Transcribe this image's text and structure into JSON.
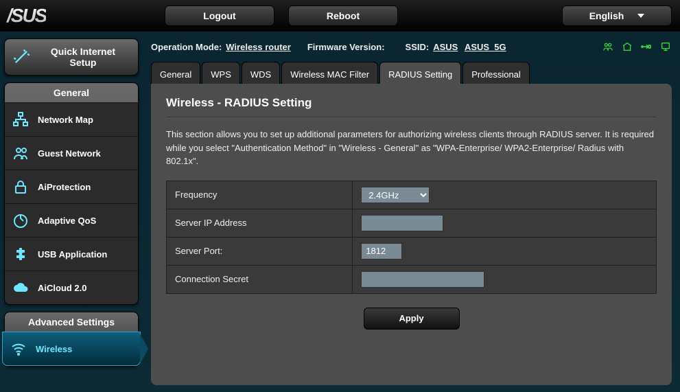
{
  "brand": "/SUS",
  "topbar": {
    "logout": "Logout",
    "reboot": "Reboot",
    "language": "English"
  },
  "status": {
    "op_mode_label": "Operation Mode:",
    "op_mode_value": "Wireless router",
    "fw_label": "Firmware Version:",
    "ssid_label": "SSID:",
    "ssid_24": "ASUS",
    "ssid_5": "ASUS_5G"
  },
  "sidebar": {
    "quick_label": "Quick Internet Setup",
    "general_header": "General",
    "general_items": [
      {
        "label": "Network Map"
      },
      {
        "label": "Guest Network"
      },
      {
        "label": "AiProtection"
      },
      {
        "label": "Adaptive QoS"
      },
      {
        "label": "USB Application"
      },
      {
        "label": "AiCloud 2.0"
      }
    ],
    "advanced_header": "Advanced Settings",
    "advanced_items": [
      {
        "label": "Wireless"
      }
    ]
  },
  "tabs": [
    {
      "label": "General"
    },
    {
      "label": "WPS"
    },
    {
      "label": "WDS"
    },
    {
      "label": "Wireless MAC Filter"
    },
    {
      "label": "RADIUS Setting"
    },
    {
      "label": "Professional"
    }
  ],
  "panel": {
    "title": "Wireless - RADIUS Setting",
    "description": "This section allows you to set up additional parameters for authorizing wireless clients through RADIUS server. It is required while you select \"Authentication Method\" in \"Wireless - General\" as \"WPA-Enterprise/ WPA2-Enterprise/ Radius with 802.1x\".",
    "fields": {
      "frequency_label": "Frequency",
      "frequency_value": "2.4GHz",
      "server_ip_label": "Server IP Address",
      "server_ip_value": "",
      "server_port_label": "Server Port:",
      "server_port_value": "1812",
      "secret_label": "Connection Secret",
      "secret_value": ""
    },
    "apply": "Apply"
  }
}
